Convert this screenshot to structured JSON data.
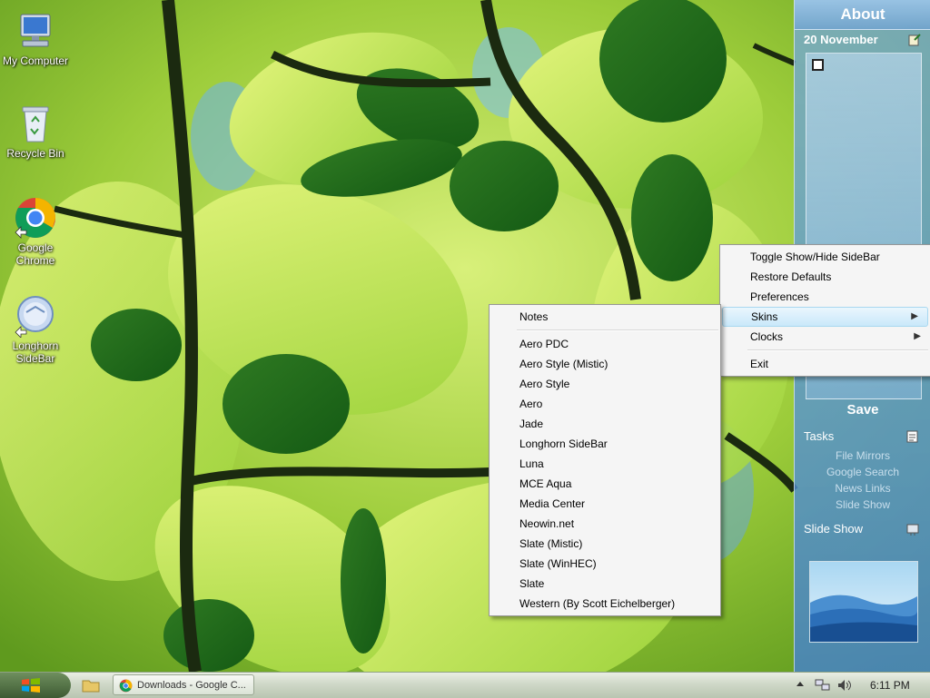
{
  "desktop": {
    "icons": [
      {
        "label": "My Computer"
      },
      {
        "label": "Recycle Bin"
      },
      {
        "label": "Google Chrome"
      },
      {
        "label": "Longhorn SideBar"
      }
    ]
  },
  "sidebar": {
    "about": "About",
    "notes_date": "20 November",
    "save": "Save",
    "tasks_title": "Tasks",
    "tasks": [
      "File Mirrors",
      "Google Search",
      "News Links",
      "Slide Show"
    ],
    "slideshow_title": "Slide Show"
  },
  "main_menu": {
    "items": [
      {
        "label": "Toggle Show/Hide SideBar"
      },
      {
        "label": "Restore Defaults"
      },
      {
        "label": "Preferences"
      },
      {
        "label": "Skins"
      },
      {
        "label": "Clocks"
      },
      {
        "label": "Exit"
      }
    ]
  },
  "skins_menu": {
    "notes": "Notes",
    "skins": [
      "Aero PDC",
      "Aero Style (Mistic)",
      "Aero Style",
      "Aero",
      "Jade",
      "Longhorn SideBar",
      "Luna",
      "MCE Aqua",
      "Media Center",
      "Neowin.net",
      "Slate (Mistic)",
      "Slate (WinHEC)",
      "Slate",
      "Western (By Scott Eichelberger)"
    ]
  },
  "taskbar": {
    "task_label": "Downloads - Google C...",
    "clock": "6:11 PM"
  },
  "colors": {
    "highlight": "#c9e8fa",
    "sidebar": "#5a96d7",
    "taskbar": "#cfd8c8"
  }
}
